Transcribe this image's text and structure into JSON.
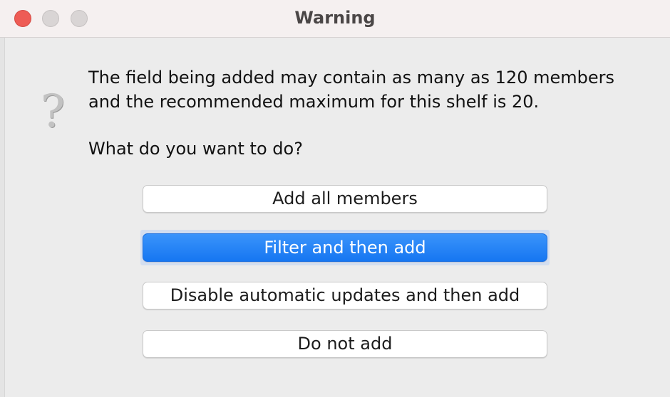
{
  "window": {
    "title": "Warning"
  },
  "icon": {
    "name": "question-mark-icon",
    "glyph": "?"
  },
  "message": {
    "line1": "The field being added may contain as many as 120 members",
    "line2": "and the recommended maximum for this shelf is 20.",
    "prompt": "What do you want to do?"
  },
  "buttons": {
    "add_all": "Add all members",
    "filter_then_add": "Filter and then add",
    "disable_updates": "Disable automatic updates and then add",
    "do_not_add": "Do not add"
  },
  "colors": {
    "close": "#ee5c55",
    "default_button": "#1676f1",
    "background": "#ececec"
  }
}
